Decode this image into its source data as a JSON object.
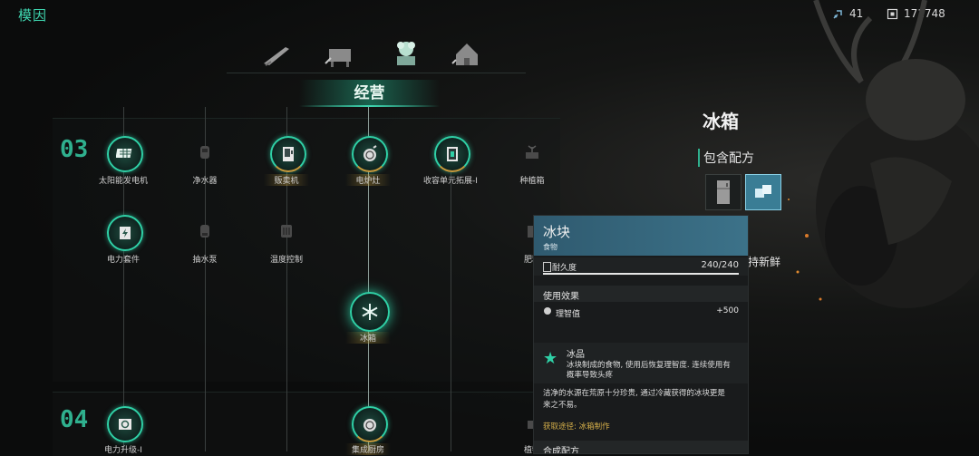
{
  "header": {
    "title": "模因",
    "res1": "41",
    "res2": "171748"
  },
  "section": {
    "title": "经营"
  },
  "tiers": [
    "03",
    "04"
  ],
  "nodes": {
    "solar": "太阳能发电机",
    "water_purifier": "净水器",
    "vending": "贩卖机",
    "stove": "电炉灶",
    "storage": "收容单元拓展-Ⅰ",
    "planter": "种植箱",
    "power_kit": "电力套件",
    "pump": "抽水泵",
    "temp": "温度控制",
    "fertilizer": "肥料",
    "fridge": "冰箱",
    "power_up": "电力升级-Ⅰ",
    "kitchen": "集成厨房",
    "plant": "植物"
  },
  "right": {
    "title": "冰箱",
    "recipe_head": "包含配方",
    "fresh": "持新鲜"
  },
  "tooltip": {
    "name": "冰块",
    "type": "食物",
    "dur_label": "耐久度",
    "dur_value": "240/240",
    "dur_fraction": 1.0,
    "use_effect": "使用效果",
    "sanity_label": "理智值",
    "sanity_value": "+500",
    "trait_name": "冰品",
    "trait_desc1": "冰块制成的食物, 使用后恢复理智度. 连续使用有",
    "trait_desc2": "概率导致头疼",
    "lore1": "洁净的水源在荒原十分珍贵, 通过冷藏获得的冰块更是",
    "lore2": "来之不易。",
    "source": "获取途径: 冰箱制作",
    "recipe": "合成配方"
  }
}
